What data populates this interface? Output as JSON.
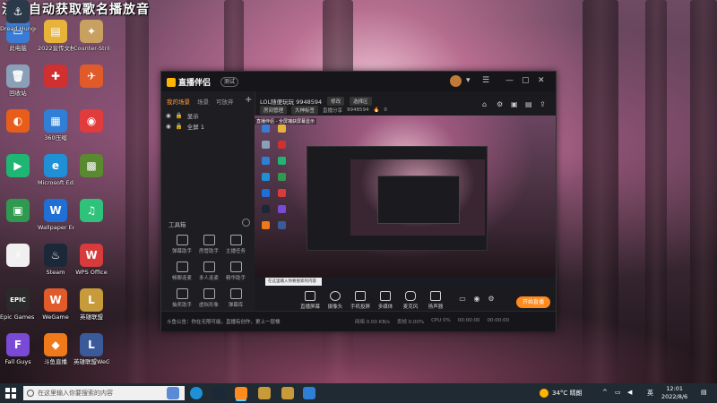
{
  "overlay_title": "沃后自动获取歌名播放音",
  "desktop_icons": [
    {
      "label": "此电脑",
      "color": "#3a7bd5",
      "glyph": "▭"
    },
    {
      "label": "2022宣传文档 电子流量影",
      "color": "#e8b33a",
      "glyph": "▤"
    },
    {
      "label": "Counter-Strike Global Off...",
      "color": "#c8a060",
      "glyph": "✦"
    },
    {
      "label": "回收站",
      "color": "#8aa0b8",
      "glyph": "🗑"
    },
    {
      "label": "",
      "color": "#d03030",
      "glyph": "✚"
    },
    {
      "label": "",
      "color": "#e05a2a",
      "glyph": "✈"
    },
    {
      "label": "",
      "color": "#e85d1a",
      "glyph": "◐"
    },
    {
      "label": "360压缩",
      "color": "#2f7fd6",
      "glyph": "▦"
    },
    {
      "label": "",
      "color": "#e23b3b",
      "glyph": "◉"
    },
    {
      "label": "",
      "color": "#1fb573",
      "glyph": "▶"
    },
    {
      "label": "Microsoft Edge",
      "color": "#1f8fd6",
      "glyph": "e"
    },
    {
      "label": "",
      "color": "#5a8a2f",
      "glyph": "▩"
    },
    {
      "label": "",
      "color": "#2f9a4f",
      "glyph": "▣"
    },
    {
      "label": "Wallpaper Engine",
      "color": "#1f6fd6",
      "glyph": "W"
    },
    {
      "label": "",
      "color": "#2fc27a",
      "glyph": "♫"
    },
    {
      "label": "",
      "color": "#f0f0f0",
      "glyph": "⚡"
    },
    {
      "label": "Steam",
      "color": "#1b2838",
      "glyph": "♨"
    },
    {
      "label": "WPS Office",
      "color": "#d83b3b",
      "glyph": "W"
    },
    {
      "label": "Epic Games Launcher",
      "color": "#2a2a2a",
      "glyph": "EPIC"
    },
    {
      "label": "WeGame",
      "color": "#e05a2a",
      "glyph": "W"
    },
    {
      "label": "英雄联盟",
      "color": "#c79a3a",
      "glyph": "L"
    },
    {
      "label": "Fall Guys",
      "color": "#7a4ad6",
      "glyph": "F"
    },
    {
      "label": "斗鱼直播",
      "color": "#f07a1a",
      "glyph": "◆"
    },
    {
      "label": "英雄联盟WeGame版",
      "color": "#3a5a9a",
      "glyph": "L"
    },
    {
      "label": "Dread Hunger",
      "color": "#2a3a4a",
      "glyph": "⚓"
    }
  ],
  "app": {
    "name": "直播伴侣",
    "badge": "测试",
    "tabs": [
      "我的场景",
      "场景",
      "可放弃"
    ],
    "active_tab": "我的场景",
    "add_label": "+",
    "scene_rows": [
      "显示",
      "全屏 1"
    ],
    "toolbox_title": "工具箱",
    "tools": [
      "弹幕助手",
      "房管助手",
      "主播任务",
      "畅聊连麦",
      "多人连麦",
      "精华助手",
      "抽奖助手",
      "虚拟形象",
      "弹幕库",
      "",
      "",
      ""
    ],
    "room_title": "LOL随便玩玩 9948594",
    "room_tag": "修改",
    "room_edit": "选择区",
    "room_row2": [
      "房间管理",
      "大神标签",
      "直播分享",
      "9948594",
      "0"
    ],
    "right_icons": [
      "⌂",
      "⚙",
      "▣",
      "▤",
      "≡",
      "⇪"
    ],
    "window_controls": [
      "—",
      "▢",
      "✕"
    ],
    "preview_label": "直播伴侣 - 全屏捕获屏幕显示",
    "preview_search": "在这里输入你要搜索的内容",
    "controls": [
      "直播屏幕",
      "摄像头",
      "手机投屏",
      "多媒体",
      "麦克风",
      "扬声器"
    ],
    "golive_label": "开始直播",
    "status_message": "斗鱼公告：你在无限可能，直播有创作，更上一层楼",
    "status_stats": [
      "网络 0.00 KB/s",
      "丢帧 0.00%",
      "CPU 0%",
      "00:00:00",
      "00:00:00"
    ]
  },
  "taskbar": {
    "search_placeholder": "在这里输入你要搜索的内容",
    "weather": "34°C 晴朗",
    "ime": "英",
    "time": "12:01",
    "date": "2022/8/6"
  },
  "colors": {
    "accent": "#ff8a1e",
    "taskbar": "#1f2a33"
  }
}
